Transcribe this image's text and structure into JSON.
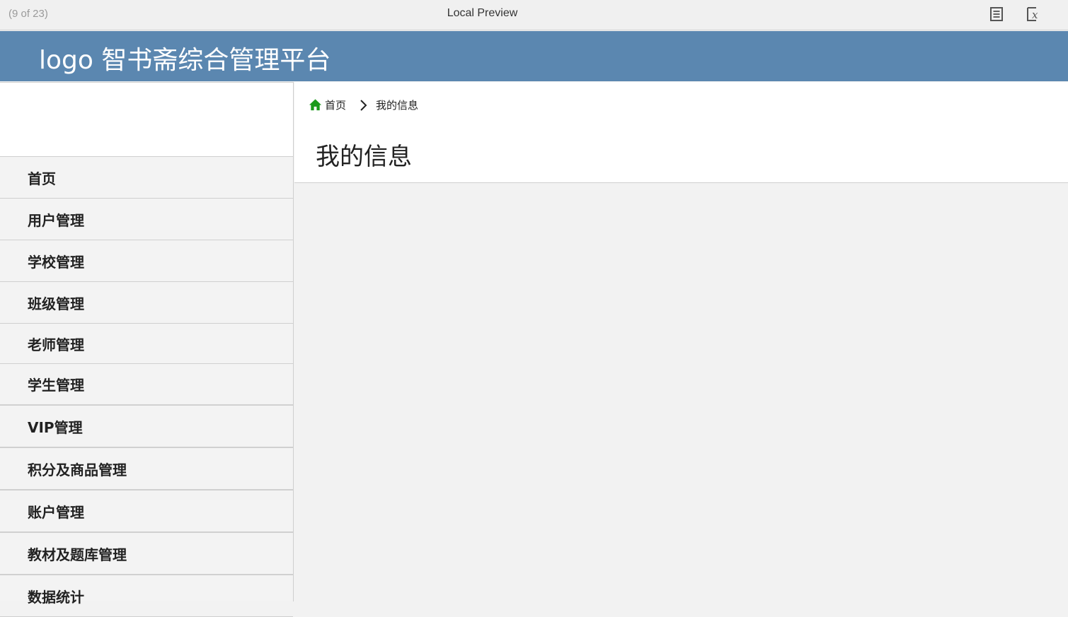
{
  "preview": {
    "counter": "(9 of 23)",
    "title": "Local Preview"
  },
  "header": {
    "title": "logo 智书斋综合管理平台"
  },
  "sidebar": {
    "items": [
      {
        "label": "首页"
      },
      {
        "label": "用户管理"
      },
      {
        "label": "学校管理"
      },
      {
        "label": "班级管理"
      },
      {
        "label": "老师管理"
      },
      {
        "label": "学生管理"
      },
      {
        "label": "VIP管理"
      },
      {
        "label": "积分及商品管理"
      },
      {
        "label": "账户管理"
      },
      {
        "label": "教材及题库管理"
      },
      {
        "label": "数据统计"
      }
    ]
  },
  "breadcrumb": {
    "home": "首页",
    "current": "我的信息"
  },
  "page": {
    "title": "我的信息"
  },
  "colors": {
    "header_bg": "#5b87b0",
    "home_icon": "#1a9a1a"
  },
  "icons": {
    "notes": "notes-icon",
    "close": "close-preview-icon",
    "home": "home-icon",
    "separator": "chevron-right-icon"
  }
}
